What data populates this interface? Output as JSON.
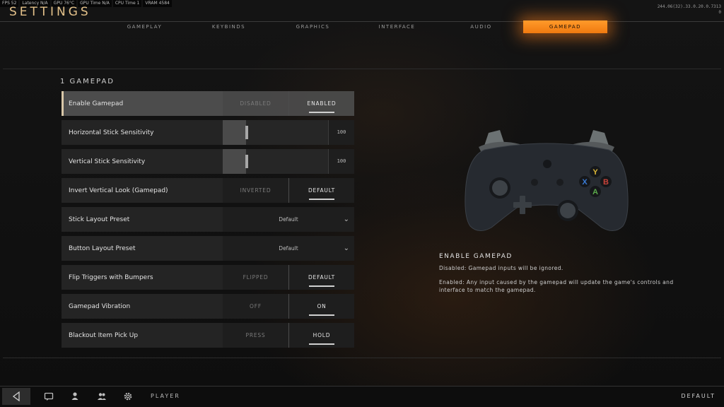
{
  "perf": [
    "FPS 52",
    "Latency N/A",
    "GPU 76°C",
    "GPU Time N/A",
    "CPU Time 1",
    "VRAM 4584"
  ],
  "build": {
    "line1": "244.06(32).33.0.20.0.7313",
    "line2": "0"
  },
  "title": "SETTINGS",
  "tabs": [
    {
      "label": "GAMEPLAY",
      "active": false
    },
    {
      "label": "KEYBINDS",
      "active": false
    },
    {
      "label": "GRAPHICS",
      "active": false
    },
    {
      "label": "INTERFACE",
      "active": false
    },
    {
      "label": "AUDIO",
      "active": false
    },
    {
      "label": "GAMEPAD",
      "active": true
    }
  ],
  "section": {
    "title": "1 GAMEPAD"
  },
  "rows": [
    {
      "label": "Enable Gamepad",
      "type": "toggle",
      "options": [
        "DISABLED",
        "ENABLED"
      ],
      "selected": 1
    },
    {
      "label": "Horizontal Stick Sensitivity",
      "type": "slider",
      "value": "100"
    },
    {
      "label": "Vertical Stick Sensitivity",
      "type": "slider",
      "value": "100"
    },
    {
      "label": "Invert Vertical Look (Gamepad)",
      "type": "toggle",
      "options": [
        "INVERTED",
        "DEFAULT"
      ],
      "selected": 1
    },
    {
      "label": "Stick Layout Preset",
      "type": "dropdown",
      "value": "Default"
    },
    {
      "label": "Button Layout Preset",
      "type": "dropdown",
      "value": "Default"
    },
    {
      "label": "Flip Triggers with Bumpers",
      "type": "toggle",
      "options": [
        "FLIPPED",
        "DEFAULT"
      ],
      "selected": 1
    },
    {
      "label": "Gamepad Vibration",
      "type": "toggle",
      "options": [
        "OFF",
        "ON"
      ],
      "selected": 1
    },
    {
      "label": "Blackout Item Pick Up",
      "type": "toggle",
      "options": [
        "PRESS",
        "HOLD"
      ],
      "selected": 1
    }
  ],
  "controller": {
    "buttons": {
      "y": "Y",
      "x": "X",
      "b": "B",
      "a": "A"
    }
  },
  "description": {
    "heading": "ENABLE GAMEPAD",
    "line1": "Disabled: Gamepad inputs will be ignored.",
    "line2": "Enabled: Any input caused by the gamepad will update the game's controls and interface to match the gamepad."
  },
  "bottom": {
    "player_label": "PLAYER",
    "default_label": "DEFAULT"
  },
  "colors": {
    "accent": "#f08a1c",
    "title": "#e3c18a"
  }
}
